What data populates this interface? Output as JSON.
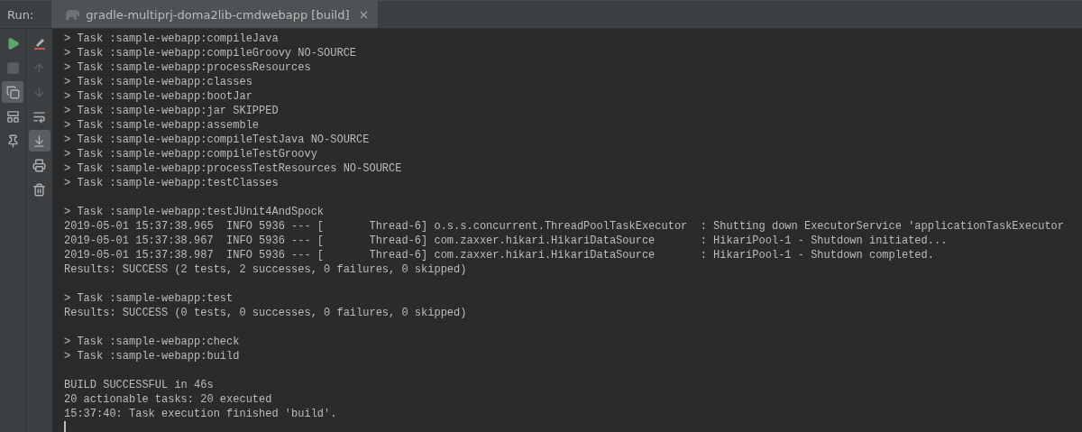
{
  "run_bar": {
    "label": "Run:",
    "tab": {
      "title": "gradle-multiprj-doma2lib-cmdwebapp [build]",
      "selected": true,
      "close": "×"
    }
  },
  "left_toolbar": [
    {
      "kind": "run",
      "disabled": false,
      "selected": false
    },
    {
      "kind": "stop",
      "disabled": true,
      "selected": false
    },
    {
      "kind": "restore-layout",
      "disabled": false,
      "selected": true
    },
    {
      "kind": "layout",
      "disabled": false,
      "selected": false
    },
    {
      "kind": "pin",
      "disabled": false,
      "selected": false
    }
  ],
  "console_toolbar": [
    {
      "kind": "clear",
      "disabled": false,
      "selected": false
    },
    {
      "kind": "up",
      "disabled": true,
      "selected": false
    },
    {
      "kind": "down",
      "disabled": true,
      "selected": false
    },
    {
      "kind": "soft-wrap",
      "disabled": false,
      "selected": false
    },
    {
      "kind": "scroll-to-end",
      "disabled": false,
      "selected": true
    },
    {
      "kind": "print",
      "disabled": false,
      "selected": false
    },
    {
      "kind": "delete",
      "disabled": false,
      "selected": false
    }
  ],
  "console": {
    "blocks": [
      [
        "> Task :sample-webapp:compileJava",
        "> Task :sample-webapp:compileGroovy NO-SOURCE",
        "> Task :sample-webapp:processResources",
        "> Task :sample-webapp:classes",
        "> Task :sample-webapp:bootJar",
        "> Task :sample-webapp:jar SKIPPED",
        "> Task :sample-webapp:assemble",
        "> Task :sample-webapp:compileTestJava NO-SOURCE",
        "> Task :sample-webapp:compileTestGroovy",
        "> Task :sample-webapp:processTestResources NO-SOURCE",
        "> Task :sample-webapp:testClasses"
      ],
      [
        "> Task :sample-webapp:testJUnit4AndSpock",
        "2019-05-01 15:37:38.965  INFO 5936 --- [       Thread-6] o.s.s.concurrent.ThreadPoolTaskExecutor  : Shutting down ExecutorService 'applicationTaskExecutor",
        "2019-05-01 15:37:38.967  INFO 5936 --- [       Thread-6] com.zaxxer.hikari.HikariDataSource       : HikariPool-1 - Shutdown initiated...",
        "2019-05-01 15:37:38.987  INFO 5936 --- [       Thread-6] com.zaxxer.hikari.HikariDataSource       : HikariPool-1 - Shutdown completed.",
        "Results: SUCCESS (2 tests, 2 successes, 0 failures, 0 skipped)"
      ],
      [
        "> Task :sample-webapp:test",
        "Results: SUCCESS (0 tests, 0 successes, 0 failures, 0 skipped)"
      ],
      [
        "> Task :sample-webapp:check",
        "> Task :sample-webapp:build"
      ],
      [
        "BUILD SUCCESSFUL in 46s",
        "20 actionable tasks: 20 executed",
        "15:37:40: Task execution finished 'build'."
      ]
    ],
    "cursor": true
  }
}
